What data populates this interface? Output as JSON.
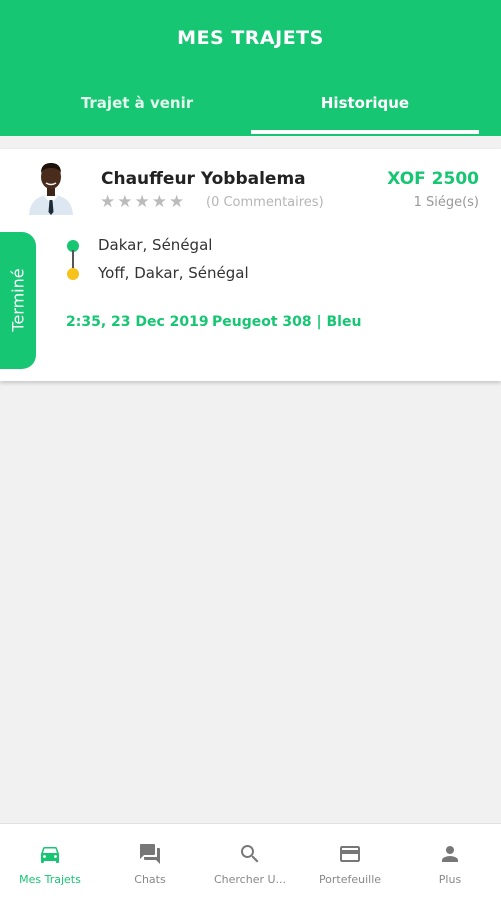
{
  "header": {
    "title": "MES TRAJETS",
    "tabs": [
      {
        "label": "Trajet à venir",
        "active": false
      },
      {
        "label": "Historique",
        "active": true
      }
    ]
  },
  "trip": {
    "driver_name": "Chauffeur Yobbalema",
    "rating_stars": "★★★★★",
    "comments": "(0 Commentaires)",
    "price": "XOF 2500",
    "seats": "1 Siége(s)",
    "origin": "Dakar, Sénégal",
    "destination": "Yoff, Dakar, Sénégal",
    "datetime": "2:35, 23 Dec 2019",
    "vehicle": "Peugeot 308 | Bleu",
    "status": "Terminé"
  },
  "bottom_nav": {
    "items": [
      {
        "label": "Mes Trajets",
        "icon": "car-icon",
        "active": true
      },
      {
        "label": "Chats",
        "icon": "chat-icon",
        "active": false
      },
      {
        "label": "Chercher U...",
        "icon": "search-icon",
        "active": false
      },
      {
        "label": "Portefeuille",
        "icon": "wallet-icon",
        "active": false
      },
      {
        "label": "Plus",
        "icon": "user-icon",
        "active": false
      }
    ]
  },
  "colors": {
    "accent": "#16c672",
    "destination_dot": "#f7c31a",
    "background": "#f1f1f1"
  }
}
